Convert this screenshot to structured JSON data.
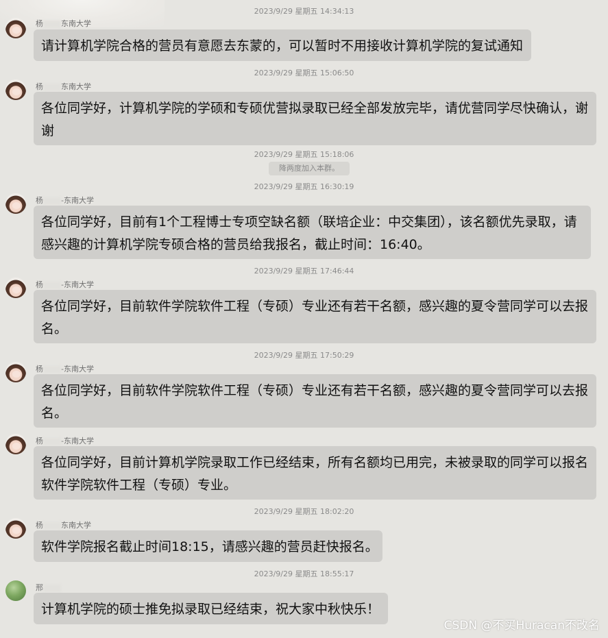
{
  "messages": [
    {
      "timestamp": "2023/9/29 星期五 14:34:13",
      "sender_prefix": "杨",
      "sender_suffix": "东南大学",
      "lines": [
        "请计算机学院合格的营员有意愿去东蒙的，可以暂时不用接收计算机学院的复试通知"
      ]
    },
    {
      "timestamp": "2023/9/29 星期五 15:06:50",
      "sender_prefix": "杨",
      "sender_suffix": "东南大学",
      "lines": [
        "各位同学好，计算机学院的学硕和专硕优营拟录取已经全部发放完毕，请优营同学尽快确认，谢",
        "谢"
      ]
    },
    {
      "timestamp": "2023/9/29 星期五 16:30:19",
      "sender_prefix": "杨",
      "sender_suffix": "-东南大学",
      "lines": [
        "各位同学好，目前有1个工程博士专项空缺名额（联培企业：中交集团），该名额优先录取，请",
        "感兴趣的计算机学院专硕合格的营员给我报名，截止时间：16:40。"
      ]
    },
    {
      "timestamp": "2023/9/29 星期五 17:46:44",
      "sender_prefix": "杨",
      "sender_suffix": "-东南大学",
      "lines": [
        "各位同学好，目前软件学院软件工程（专硕）专业还有若干名额，感兴趣的夏令营同学可以去报",
        "名。"
      ]
    },
    {
      "timestamp": "2023/9/29 星期五 17:50:29",
      "sender_prefix": "杨",
      "sender_suffix": "-东南大学",
      "lines": [
        "各位同学好，目前软件学院软件工程（专硕）专业还有若干名额，感兴趣的夏令营同学可以去报",
        "名。"
      ]
    },
    {
      "timestamp": "",
      "sender_prefix": "杨",
      "sender_suffix": "-东南大学",
      "lines": [
        "各位同学好，目前计算机学院录取工作已经结束，所有名额均已用完，未被录取的同学可以报名",
        "软件学院软件工程（专硕）专业。"
      ]
    },
    {
      "timestamp": "2023/9/29 星期五 18:02:20",
      "sender_prefix": "杨",
      "sender_suffix": "东南大学",
      "lines": [
        "软件学院报名截止时间18:15，请感兴趣的营员赶快报名。"
      ]
    },
    {
      "timestamp": "2023/9/29 星期五 18:55:17",
      "sender_prefix": "邢",
      "sender_suffix": "",
      "lines": [
        "计算机学院的硕士推免拟录取已经结束，祝大家中秋快乐！"
      ]
    }
  ],
  "system_notice": {
    "timestamp": "2023/9/29 星期五 15:18:06",
    "text": "降两度加入本群。"
  },
  "watermark": "CSDN @不买Huracan不改名",
  "colors": {
    "background": "#e6e5e1",
    "bubble": "#cfcecb",
    "timestamp_text": "#8a8a8a",
    "message_text": "#111111"
  }
}
